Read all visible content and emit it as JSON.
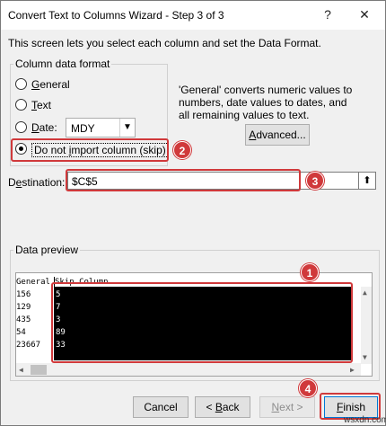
{
  "window": {
    "title": "Convert Text to Columns Wizard - Step 3 of 3",
    "help_glyph": "?",
    "close_glyph": "✕"
  },
  "intro": "This screen lets you select each column and set the Data Format.",
  "column_format": {
    "legend": "Column data format",
    "options": [
      {
        "label": "General",
        "checked": false
      },
      {
        "label": "Text",
        "checked": false
      },
      {
        "label": "Date:",
        "checked": false
      },
      {
        "label": "Do not import column (skip)",
        "checked": true
      }
    ],
    "date_format": "MDY"
  },
  "help_text": "'General' converts numeric values to numbers, date values to dates, and all remaining values to text.",
  "advanced_label": "Advanced...",
  "destination": {
    "label": "Destination:",
    "value": "$C$5"
  },
  "preview": {
    "label": "Data preview",
    "headers": [
      "General",
      "Skip Column"
    ],
    "rows": [
      [
        "156",
        "5"
      ],
      [
        "129",
        "7"
      ],
      [
        "435",
        "3"
      ],
      [
        "54",
        "89"
      ],
      [
        "23667",
        "33"
      ]
    ]
  },
  "buttons": {
    "cancel": "Cancel",
    "back": "< Back",
    "next": "Next >",
    "finish": "Finish"
  },
  "badges": [
    "1",
    "2",
    "3",
    "4"
  ],
  "watermark": "wsxdn.com",
  "colors": {
    "annotation": "#d0393b",
    "focus": "#0078d7"
  }
}
